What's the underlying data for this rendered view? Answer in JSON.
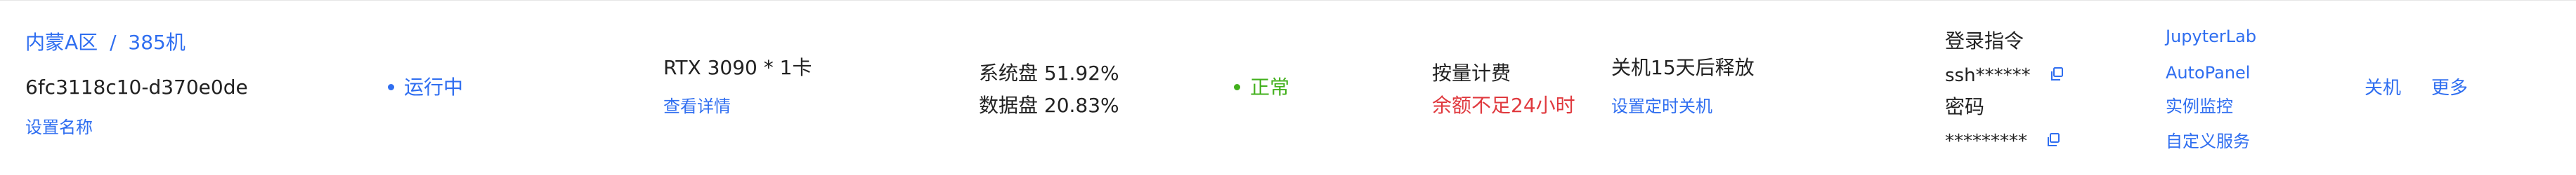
{
  "instance": {
    "region": "内蒙A区",
    "separator": "/",
    "machine": "385机",
    "id": "6fc3118c10-d370e0de",
    "set_name_label": "设置名称"
  },
  "status": {
    "label": "运行中",
    "color": "#2f6ef0"
  },
  "gpu": {
    "spec": "RTX 3090 * 1卡",
    "details_link": "查看详情"
  },
  "disks": {
    "system": "系统盘 51.92%",
    "data": "数据盘 20.83%"
  },
  "health": {
    "label": "正常",
    "color": "#42b01c"
  },
  "billing": {
    "mode": "按量计费",
    "warning": "余额不足24小时",
    "warning_color": "#e0393e"
  },
  "release": {
    "policy": "关机15天后释放",
    "schedule_link": "设置定时关机"
  },
  "login": {
    "command_label": "登录指令",
    "command_value": "ssh******",
    "password_label": "密码",
    "password_value": "*********",
    "copy_icon": "copy-icon"
  },
  "links": {
    "jupyter": "JupyterLab",
    "autopanel": "AutoPanel",
    "monitor": "实例监控",
    "custom_service": "自定义服务"
  },
  "actions": {
    "shutdown": "关机",
    "more": "更多"
  },
  "colors": {
    "accent": "#2f6ef0",
    "text": "#222222"
  }
}
